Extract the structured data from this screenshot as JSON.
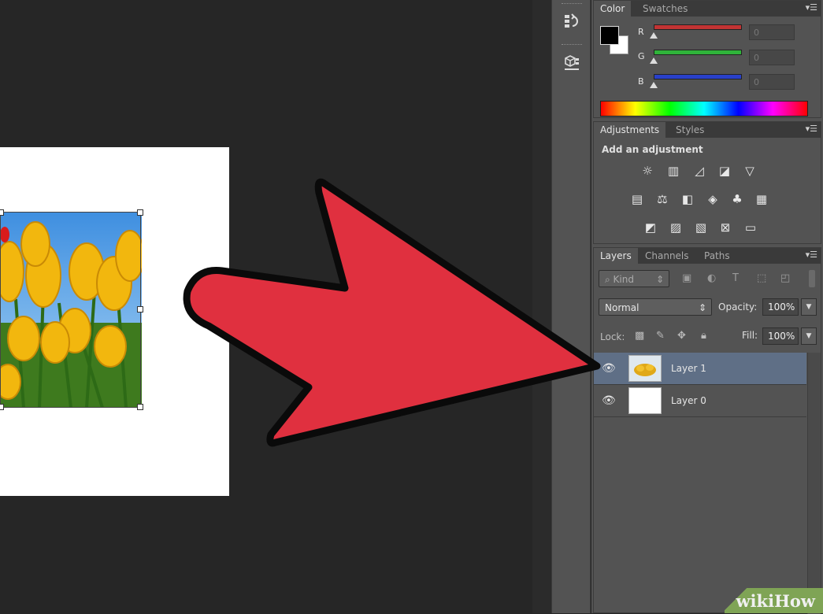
{
  "colors": {
    "accent_red": "#e0303f",
    "panel_bg": "#535353",
    "canvas_bg": "#262626",
    "selection": "#5f6f86",
    "watermark_green": "#7fa455"
  },
  "dock": {
    "icons": [
      "history-icon",
      "3d-icon"
    ]
  },
  "color_panel": {
    "tabs": [
      "Color",
      "Swatches"
    ],
    "channels": [
      {
        "label": "R",
        "value": "0",
        "track_color": "#c23434"
      },
      {
        "label": "G",
        "value": "0",
        "track_color": "#2fb33a"
      },
      {
        "label": "B",
        "value": "0",
        "track_color": "#2940c9"
      }
    ]
  },
  "adjustments_panel": {
    "tabs": [
      "Adjustments",
      "Styles"
    ],
    "heading": "Add an adjustment",
    "icons": [
      [
        "brightness-icon",
        "levels-icon",
        "curves-icon",
        "exposure-icon",
        "vibrance-icon"
      ],
      [
        "hue-saturation-icon",
        "color-balance-icon",
        "black-white-icon",
        "photo-filter-icon",
        "channel-mixer-icon",
        "color-lookup-icon"
      ],
      [
        "invert-icon",
        "posterize-icon",
        "threshold-icon",
        "selective-color-icon",
        "gradient-map-icon"
      ]
    ]
  },
  "layers_panel": {
    "tabs": [
      "Layers",
      "Channels",
      "Paths"
    ],
    "filter_label": "Kind",
    "blend_mode": "Normal",
    "opacity_label": "Opacity:",
    "opacity_value": "100%",
    "lock_label": "Lock:",
    "fill_label": "Fill:",
    "fill_value": "100%",
    "layers": [
      {
        "name": "Layer 1",
        "selected": true
      },
      {
        "name": "Layer 0",
        "selected": false
      }
    ]
  },
  "watermark": {
    "brand": "wikiHow"
  }
}
